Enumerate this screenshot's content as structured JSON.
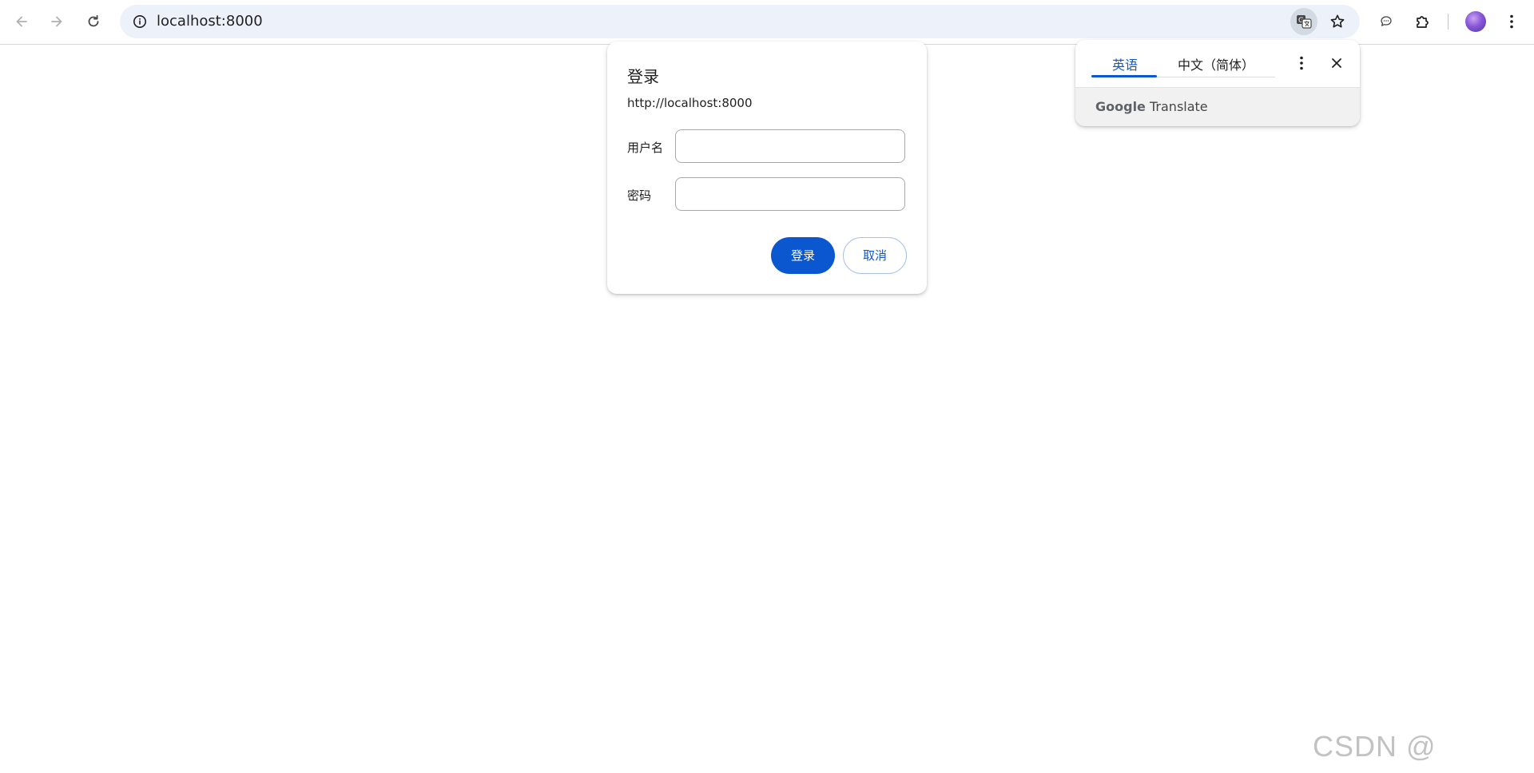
{
  "browser": {
    "url": "localhost:8000",
    "icons": {
      "back": "arrow-left-icon",
      "forward": "arrow-right-icon",
      "reload": "reload-icon",
      "site_info": "info-icon",
      "translate": "translate-icon",
      "bookmark": "star-icon",
      "chat": "chat-bubble-icon",
      "extensions": "puzzle-icon",
      "profile": "avatar",
      "menu": "kebab-icon"
    }
  },
  "dialog": {
    "title": "登录",
    "origin": "http://localhost:8000",
    "username_label": "用户名",
    "username_value": "",
    "password_label": "密码",
    "password_value": "",
    "login_button": "登录",
    "cancel_button": "取消"
  },
  "translate": {
    "tabs": [
      {
        "label": "英语",
        "active": true
      },
      {
        "label": "中文（简体）",
        "active": false
      }
    ],
    "brand_google": "Google",
    "brand_translate": "Translate"
  },
  "watermark": "CSDN @",
  "colors": {
    "primary": "#0b57d0",
    "omnibox_bg": "#edf2fa",
    "footer_bg": "#f1f1f1"
  }
}
